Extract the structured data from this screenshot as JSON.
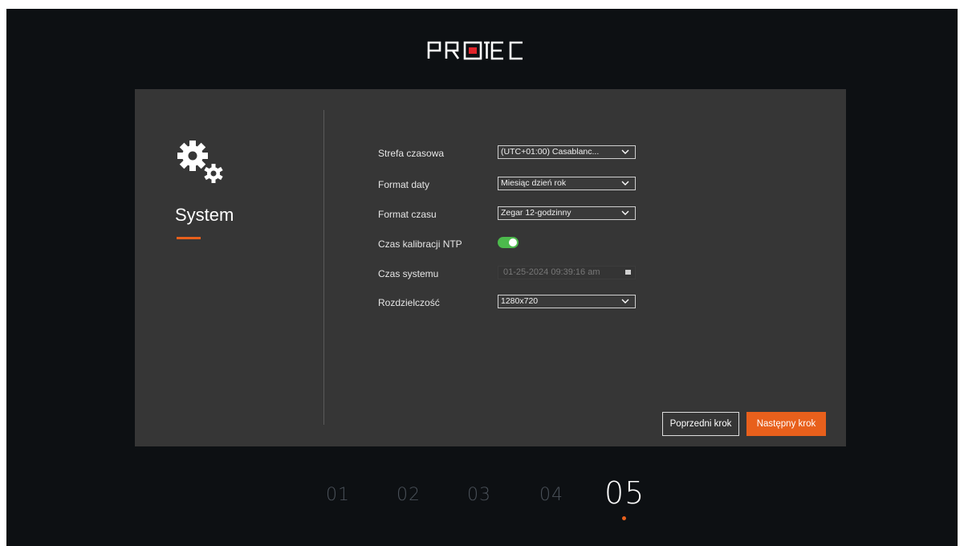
{
  "brand": {
    "name": "PROTEC",
    "accent": "#e8601c"
  },
  "section": {
    "title": "System",
    "icon": "gears-icon"
  },
  "form": {
    "timezone": {
      "label": "Strefa czasowa",
      "value": "(UTC+01:00) Casablanc..."
    },
    "date_format": {
      "label": "Format daty",
      "value": "Miesiąc dzień rok"
    },
    "time_format": {
      "label": "Format czasu",
      "value": "Zegar 12-godzinny"
    },
    "ntp": {
      "label": "Czas kalibracji NTP",
      "enabled": true
    },
    "system_time": {
      "label": "Czas systemu",
      "value": "01-25-2024 09:39:16 am"
    },
    "resolution": {
      "label": "Rozdzielczość",
      "value": "1280x720"
    }
  },
  "buttons": {
    "prev": "Poprzedni krok",
    "next": "Następny krok"
  },
  "steps": {
    "s1": "01",
    "s2": "02",
    "s3": "03",
    "s4": "04",
    "s5": "05",
    "active": "05"
  }
}
